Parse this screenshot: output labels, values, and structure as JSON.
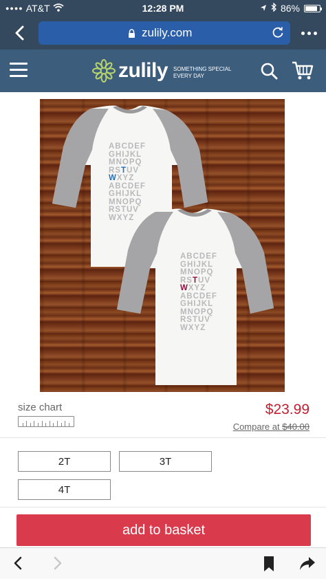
{
  "status_bar": {
    "carrier": "AT&T",
    "time": "12:28 PM",
    "battery": "86%",
    "battery_level": 0.86
  },
  "browser": {
    "url": "zulily.com"
  },
  "site_header": {
    "logo_text": "zulily",
    "tagline_line1": "SOMETHING SPECIAL",
    "tagline_line2": "EVERY DAY"
  },
  "product": {
    "shirt_left_lines": [
      "ABCDEF",
      "GHIJKL",
      "MNOPQ",
      "RSTUV",
      "WXYZ",
      "ABCDEF",
      "GHIJKL",
      "MNOPQ",
      "RSTUV",
      "WXYZ"
    ],
    "shirt_right_lines": [
      "ABCDEF",
      "GHIJKL",
      "MNOPQ",
      "RSTUV",
      "WXYZ",
      "ABCDEF",
      "GHIJKL",
      "MNOPQ",
      "RSTUV",
      "WXYZ"
    ],
    "size_chart_label": "size chart",
    "price": "$23.99",
    "compare_label": "Compare at",
    "compare_price": "$40.00",
    "sizes": [
      "2T",
      "3T",
      "4T"
    ],
    "add_button": "add to basket"
  },
  "colors": {
    "status_bg": "#34495e",
    "header_bg": "#3d5d7d",
    "url_box": "#2b5ea8",
    "price_red": "#c0202f",
    "add_button": "#d93a4c",
    "highlight_blue": "#2a6fb0",
    "highlight_maroon": "#8d1240"
  },
  "icons": {
    "back": "chevron-left-icon",
    "reload": "reload-icon",
    "more": "more-dots-icon",
    "menu": "hamburger-icon",
    "search": "search-icon",
    "cart": "cart-icon",
    "bookmark": "bookmark-icon",
    "share": "share-icon"
  }
}
